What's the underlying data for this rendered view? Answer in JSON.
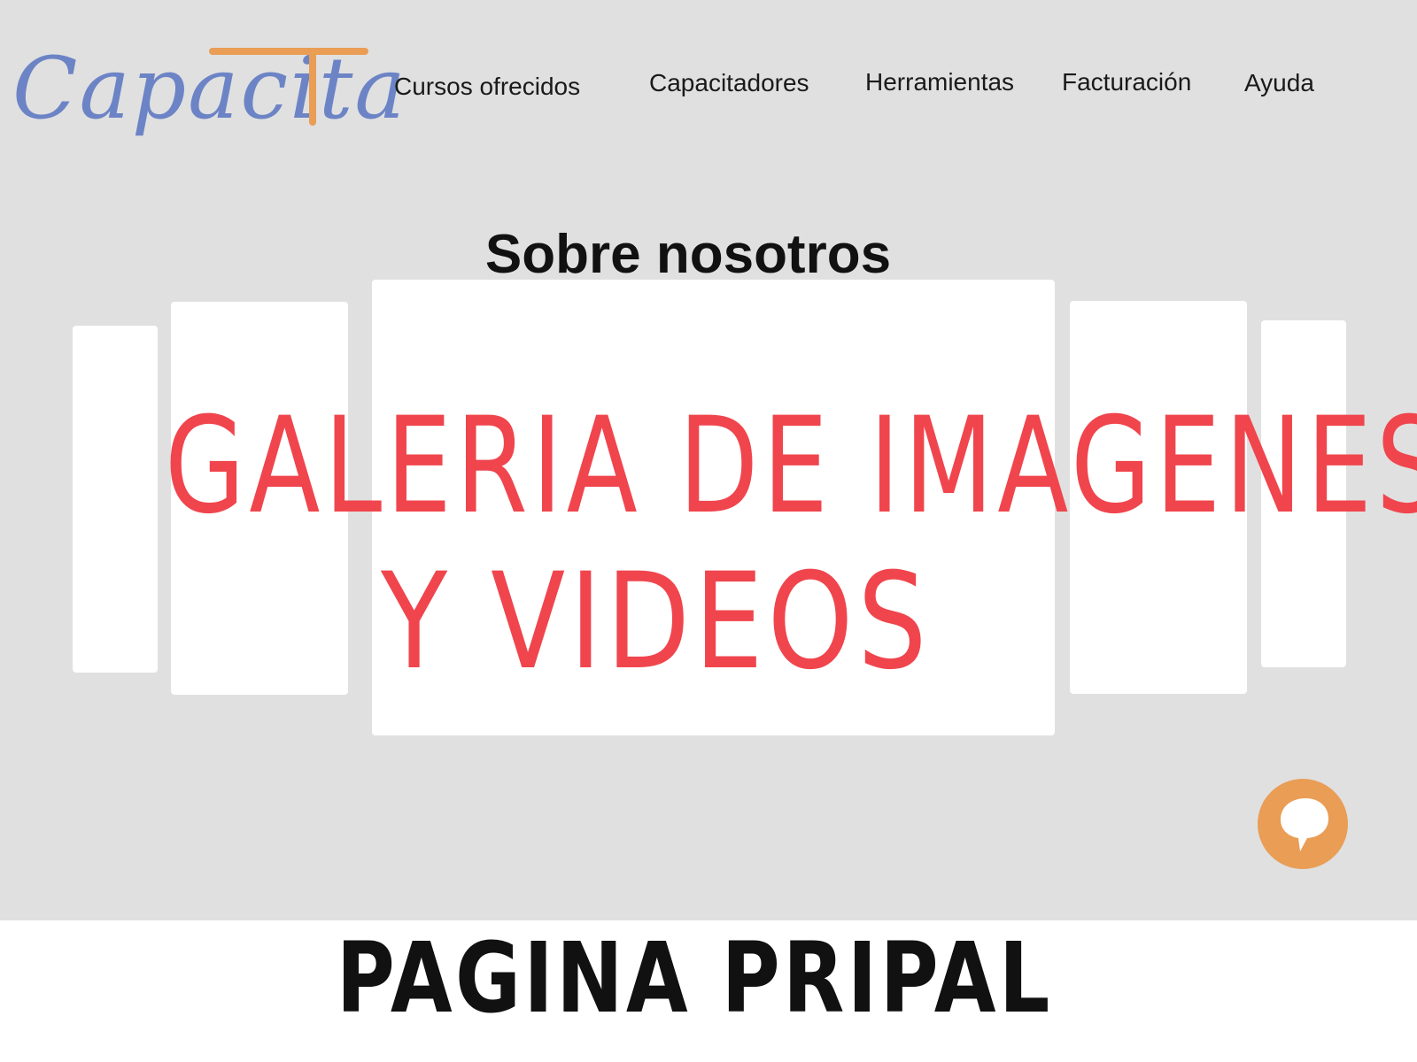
{
  "brand": {
    "logo_text": "Capacita",
    "logo_text_color": "#6c84c6",
    "logo_accent_color": "#e99d55",
    "logo_full_text": "CapacitaT"
  },
  "nav": {
    "items": [
      {
        "label": "Cursos ofrecidos"
      },
      {
        "label": "Capacitadores"
      },
      {
        "label": "Herramientas"
      },
      {
        "label": "Facturación"
      },
      {
        "label": "Ayuda"
      }
    ]
  },
  "main": {
    "section_title": "Sobre nosotros",
    "gallery": {
      "line1": "GALERIA DE IMAGENES",
      "line2": "Y VIDEOS",
      "text_color": "#f0454d"
    }
  },
  "chat": {
    "icon": "speech-bubble-icon",
    "color": "#e99d55"
  },
  "footer": {
    "label": "PAGINA PRIPAL"
  },
  "colors": {
    "canvas_bg": "#e0e0e0",
    "panel_bg": "#ffffff"
  }
}
